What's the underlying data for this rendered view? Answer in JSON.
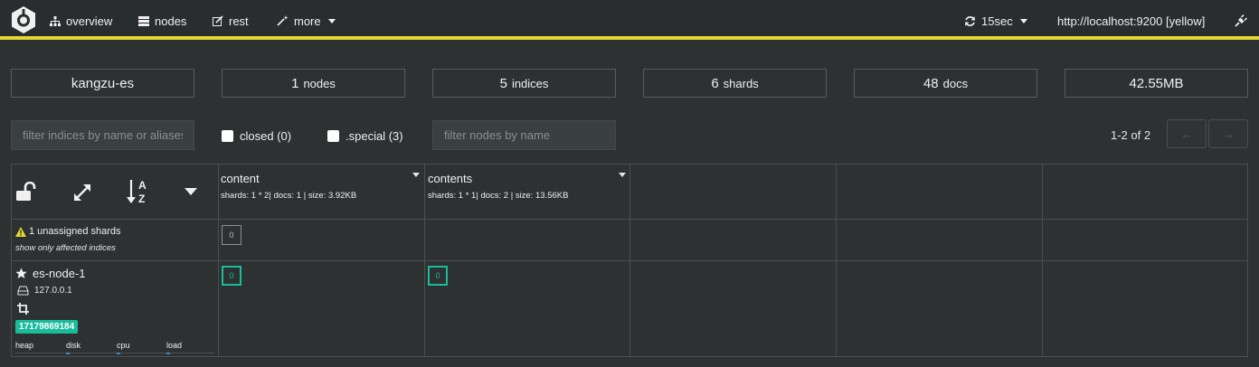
{
  "nav": {
    "items": [
      {
        "label": "overview",
        "icon": "sitemap-icon"
      },
      {
        "label": "nodes",
        "icon": "server-icon"
      },
      {
        "label": "rest",
        "icon": "edit-icon"
      },
      {
        "label": "more",
        "icon": "magic-wand-icon"
      }
    ],
    "refresh": "15sec",
    "connection": "http://localhost:9200 [yellow]",
    "accent": "#e4d932"
  },
  "stats": {
    "cluster": "kangzu-es",
    "nodes": {
      "value": "1",
      "unit": "nodes"
    },
    "indices": {
      "value": "5",
      "unit": "indices"
    },
    "shards": {
      "value": "6",
      "unit": "shards"
    },
    "docs": {
      "value": "48",
      "unit": "docs"
    },
    "size": "42.55MB"
  },
  "filters": {
    "indices_placeholder": "filter indices by name or aliases",
    "closed_label": "closed (0)",
    "special_label": ".special (3)",
    "nodes_placeholder": "filter nodes by name"
  },
  "pager": {
    "text": "1-2 of 2",
    "prev": "←",
    "next": "→"
  },
  "indices": [
    {
      "name": "content",
      "meta": "shards: 1 * 2| docs: 1 | size: 3.92KB"
    },
    {
      "name": "contents",
      "meta": "shards: 1 * 1| docs: 2 | size: 13.56KB"
    }
  ],
  "unassigned": {
    "title": "1 unassigned shards",
    "link": "show only affected indices",
    "shard": "0"
  },
  "node": {
    "name": "es-node-1",
    "ip": "127.0.0.1",
    "badge": "17179869184",
    "metrics": {
      "heap": "heap",
      "disk": "disk",
      "cpu": "cpu",
      "load": "load"
    },
    "shards": [
      "0",
      "0"
    ]
  },
  "colors": {
    "assigned": "#1abc9c",
    "warning": "#e4d932"
  }
}
